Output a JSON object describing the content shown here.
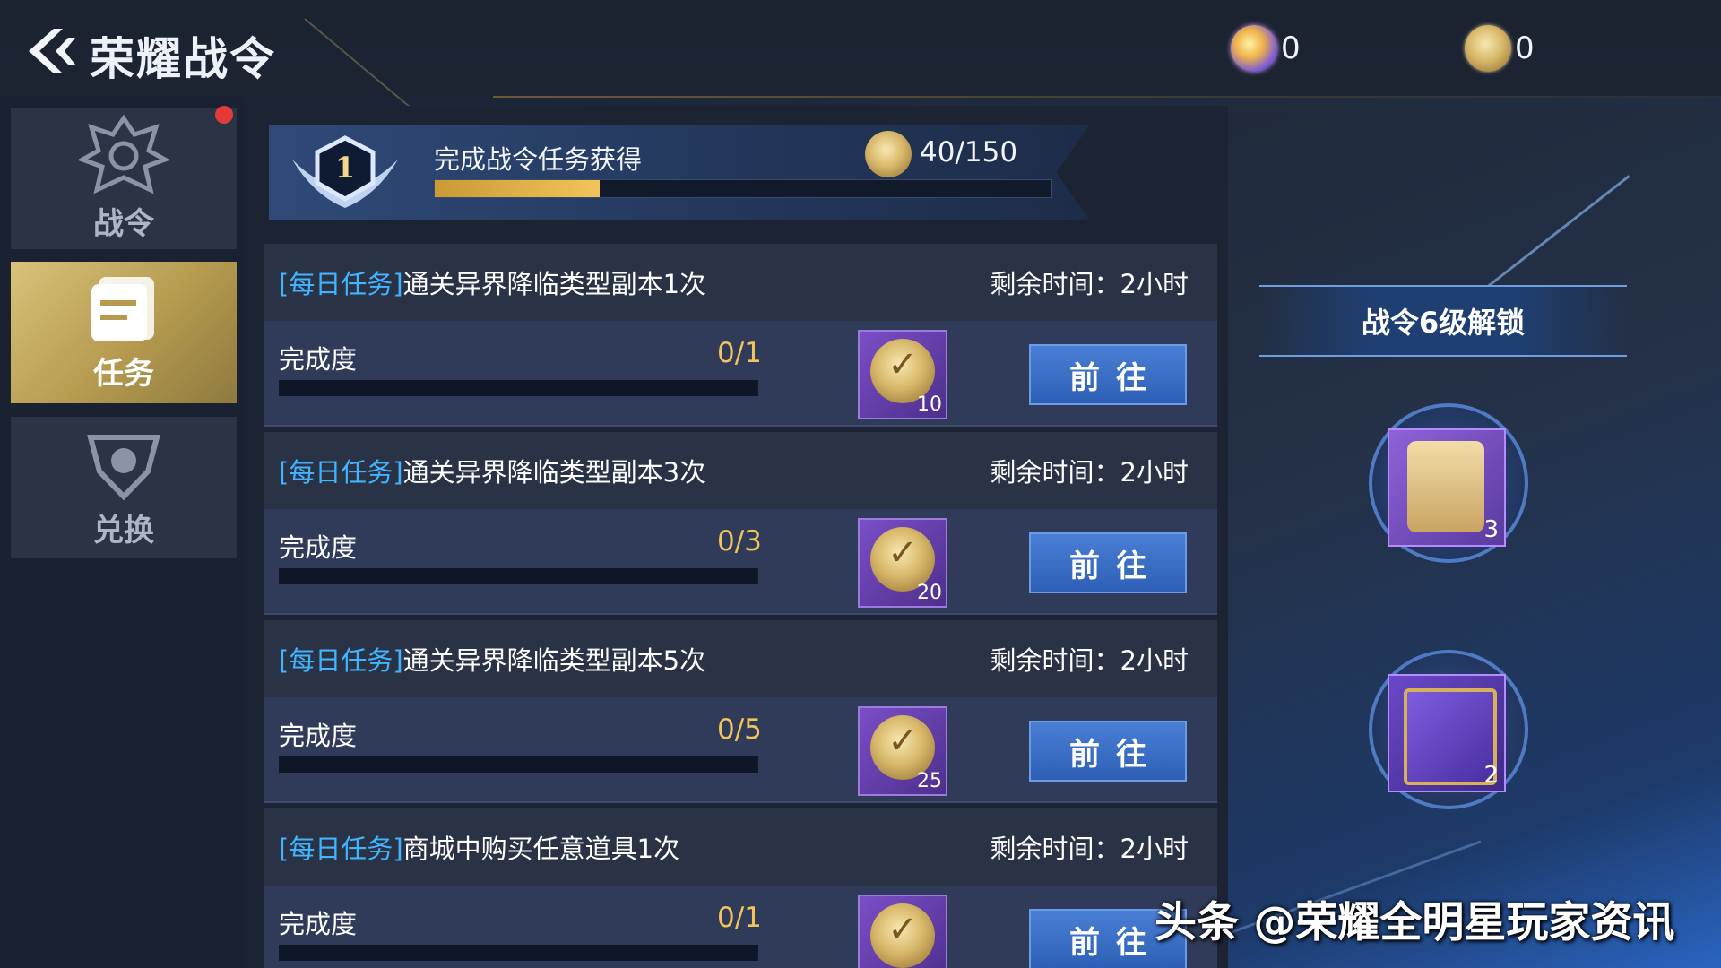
{
  "header": {
    "title": "荣耀战令",
    "currencies": [
      {
        "icon": "gem-icon",
        "value": "0"
      },
      {
        "icon": "coin-icon",
        "value": "0"
      }
    ]
  },
  "sidebar": {
    "items": [
      {
        "label": "战令",
        "icon": "battle-pass-crest-icon",
        "active": false,
        "has_notification": true
      },
      {
        "label": "任务",
        "icon": "task-scroll-icon",
        "active": true
      },
      {
        "label": "兑换",
        "icon": "exchange-shield-icon",
        "active": false
      }
    ]
  },
  "progress": {
    "level": "1",
    "label": "完成战令任务获得",
    "count": "40/150",
    "fraction": 0.267
  },
  "tasks": [
    {
      "tag": "[每日任务]",
      "title": "通关异界降临类型副本1次",
      "time": "剩余时间：2小时",
      "label": "完成度",
      "count": "0/1",
      "progress": 0,
      "reward_qty": "10",
      "button": "前往"
    },
    {
      "tag": "[每日任务]",
      "title": "通关异界降临类型副本3次",
      "time": "剩余时间：2小时",
      "label": "完成度",
      "count": "0/3",
      "progress": 0,
      "reward_qty": "20",
      "button": "前往"
    },
    {
      "tag": "[每日任务]",
      "title": "通关异界降临类型副本5次",
      "time": "剩余时间：2小时",
      "label": "完成度",
      "count": "0/5",
      "progress": 0,
      "reward_qty": "25",
      "button": "前往"
    },
    {
      "tag": "[每日任务]",
      "title": "商城中购买任意道具1次",
      "time": "剩余时间：2小时",
      "label": "完成度",
      "count": "0/1",
      "progress": 0,
      "reward_qty": "",
      "button": "前往"
    }
  ],
  "unlock": {
    "title": "战令6级解锁",
    "rewards": [
      {
        "icon": "reward-pack-icon",
        "qty": "3"
      },
      {
        "icon": "spell-book-icon",
        "qty": "2"
      }
    ]
  },
  "watermark": "头条 @荣耀全明星玩家资讯",
  "colors": {
    "accent_gold": "#f2c45a",
    "task_tag_blue": "#42b4ff",
    "button_blue": "#2d5fb6"
  }
}
